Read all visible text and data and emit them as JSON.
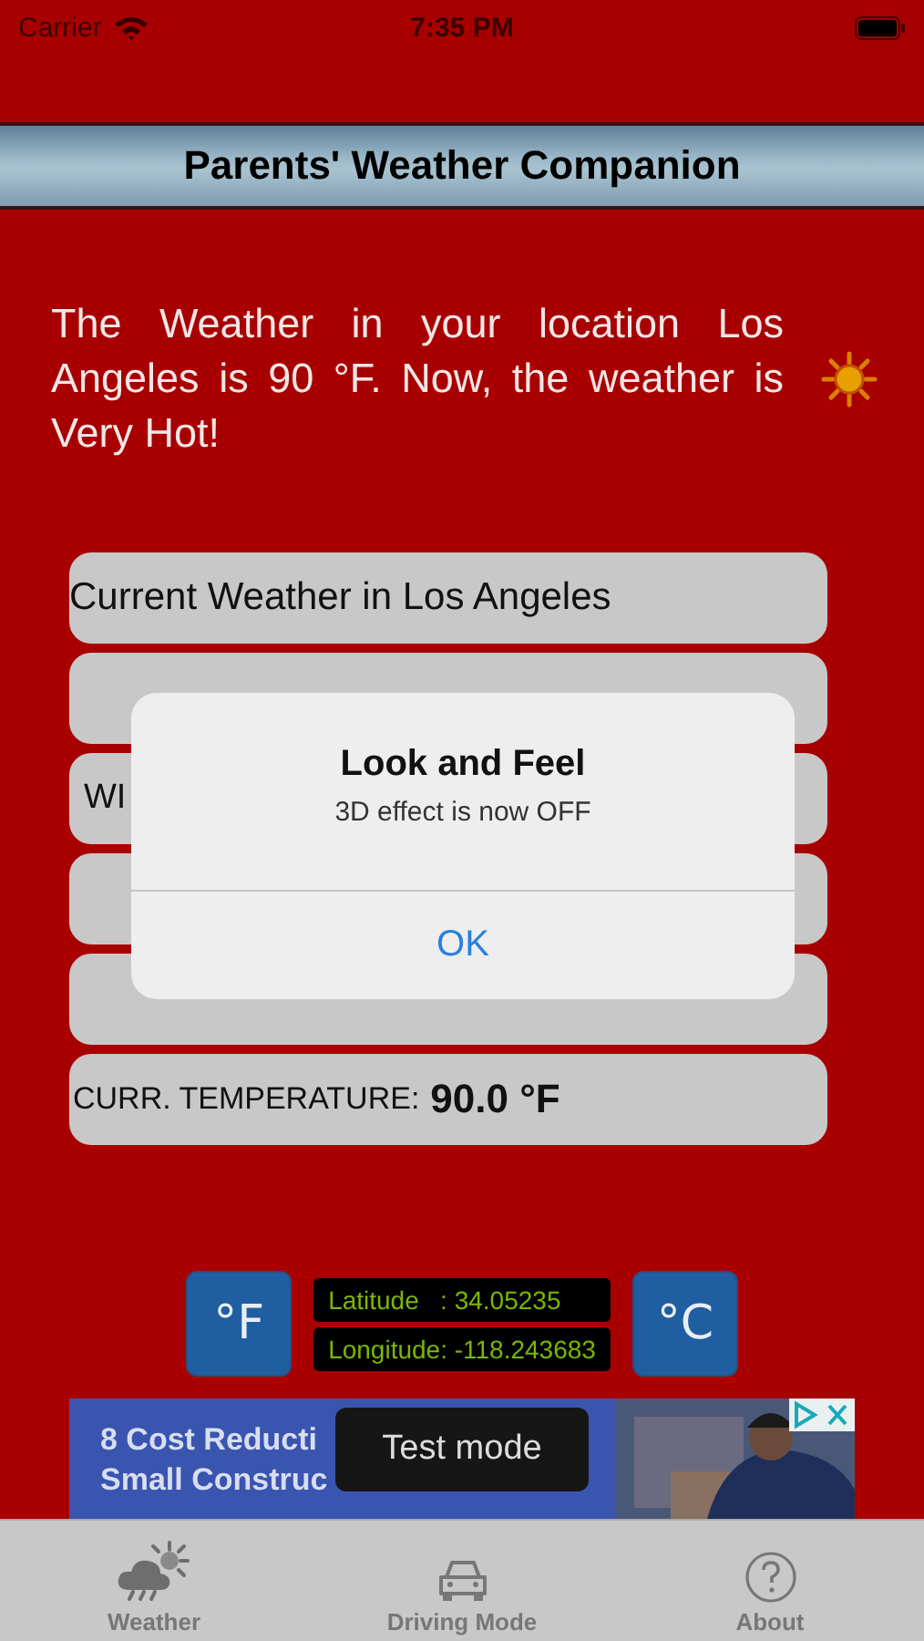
{
  "status_bar": {
    "carrier": "Carrier",
    "time": "7:35 PM"
  },
  "title": "Parents' Weather Companion",
  "message": "The Weather in your location Los Angeles is 90 °F. Now, the weather is Very Hot!",
  "weather_rows": [
    {
      "kind": "header",
      "label": "Current Weather in  Los Angeles"
    },
    {
      "kind": "field"
    },
    {
      "kind": "field",
      "label": "WI"
    },
    {
      "kind": "field"
    },
    {
      "kind": "field"
    },
    {
      "kind": "field",
      "label": "CURR. TEMPERATURE:",
      "value": "90.0 °F"
    }
  ],
  "units": [
    "°F",
    "°C"
  ],
  "coordinates": [
    "Latitude   : 34.05235",
    "Longitude: -118.243683"
  ],
  "ad": {
    "lines": [
      "8 Cost Reducti",
      "Small Construc"
    ]
  },
  "toast": "Test mode",
  "alert": {
    "title": "Look and Feel",
    "message": "3D effect is now OFF",
    "button": "OK"
  },
  "tabs": [
    {
      "label": "Weather"
    },
    {
      "label": "Driving Mode"
    },
    {
      "label": "About"
    }
  ]
}
